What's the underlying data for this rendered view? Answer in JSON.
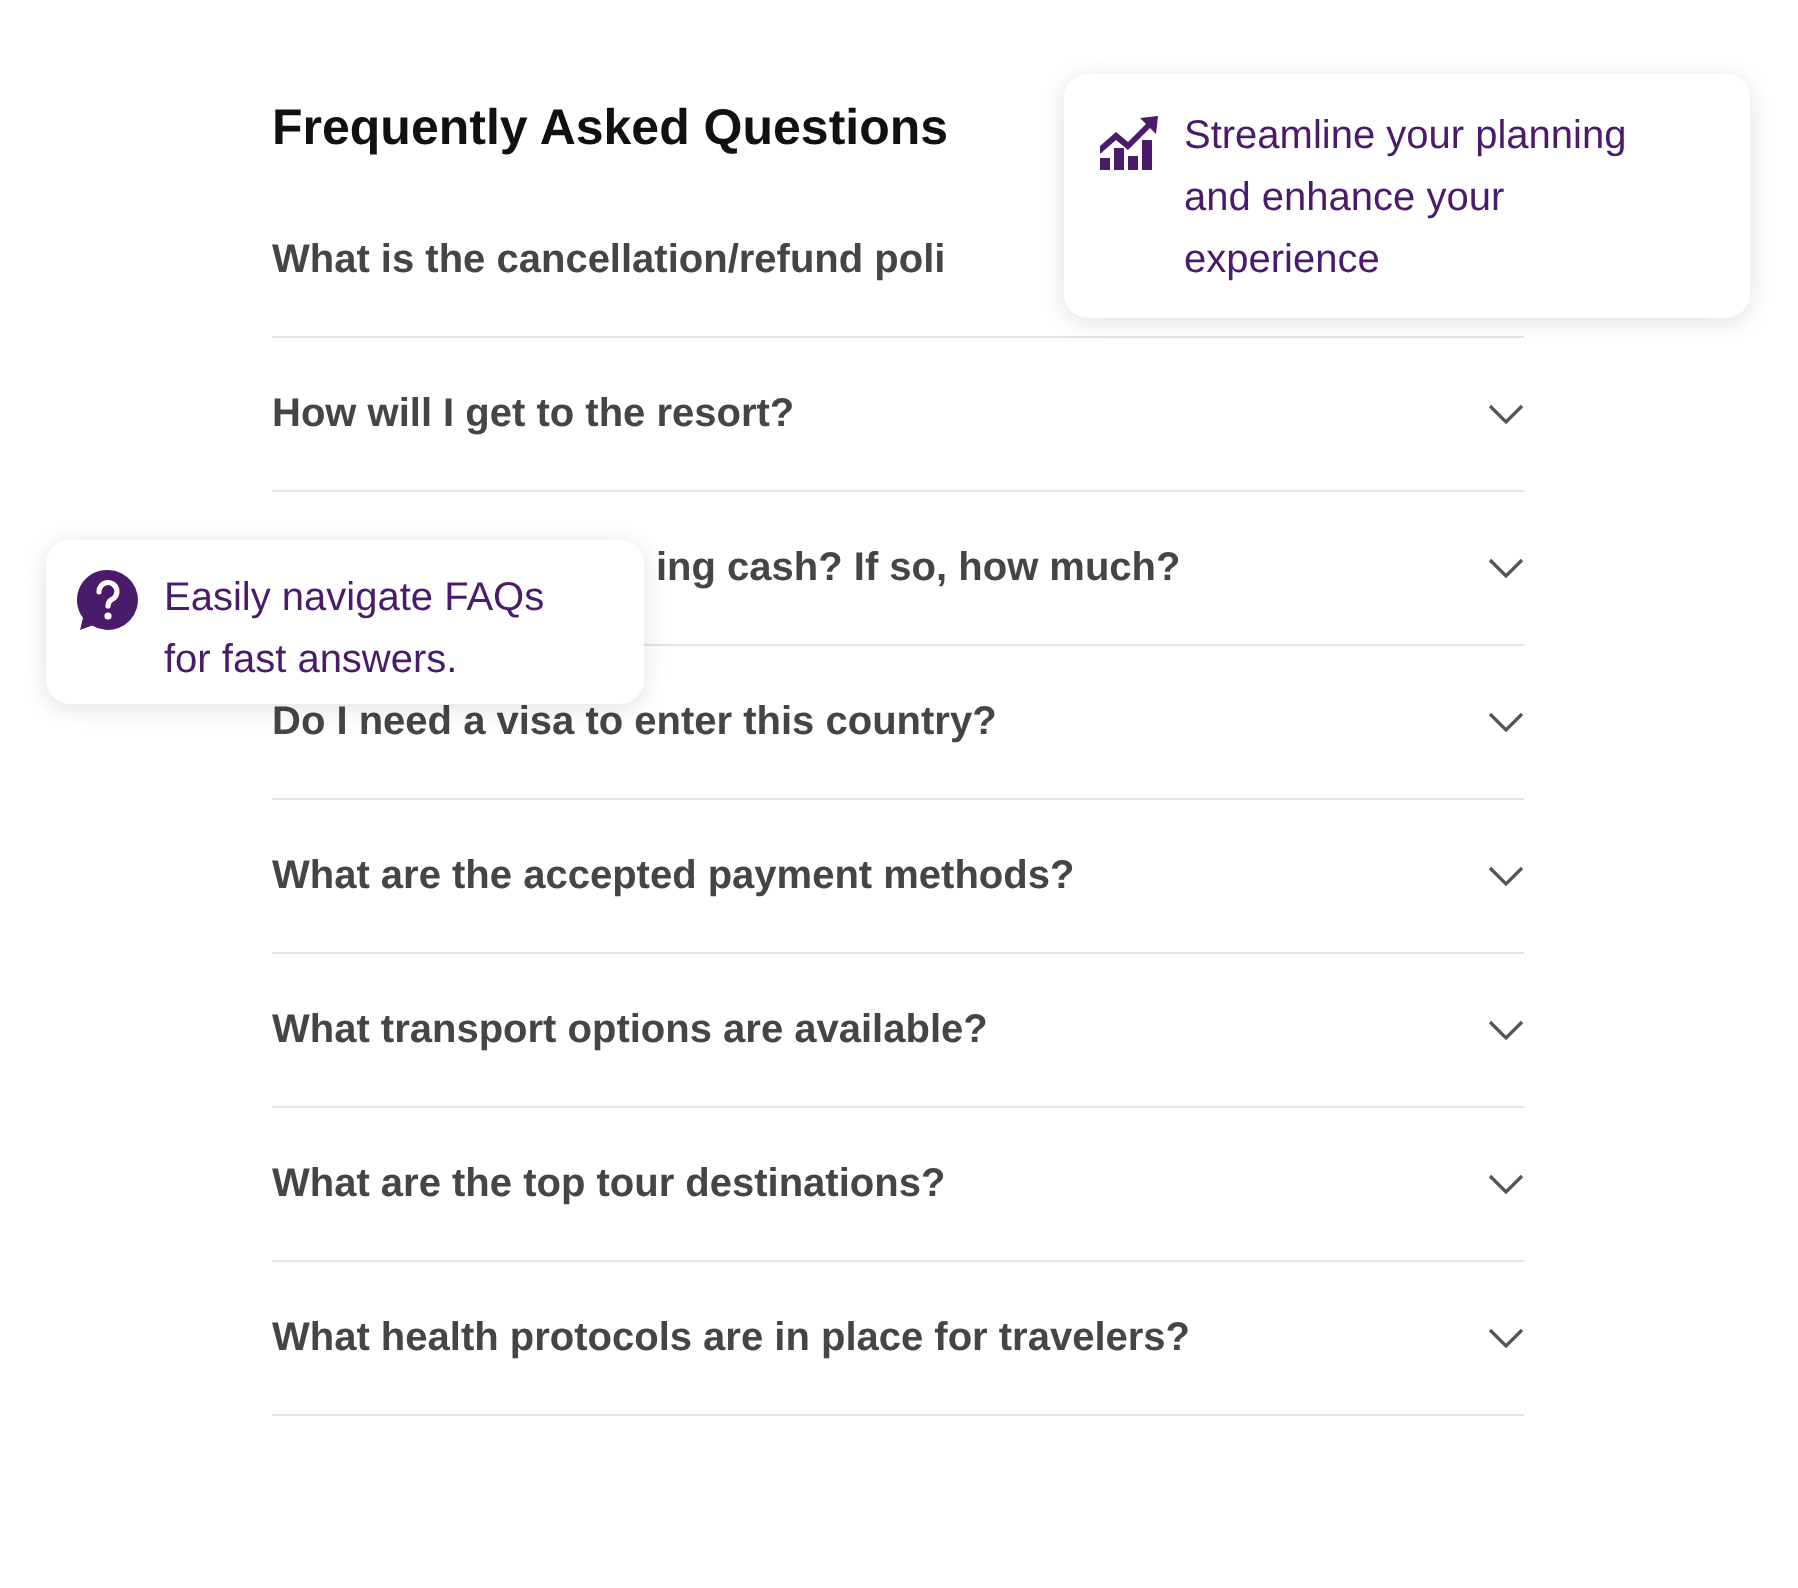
{
  "title": "Frequently Asked Questions",
  "questions": [
    {
      "text": "What is the cancellation/refund poli",
      "kind": "hidden_end"
    },
    {
      "text": "How will I get to the resort?",
      "expanded": false
    },
    {
      "text": "ing cash? If so, how much?",
      "expanded": false,
      "kind": "hidden_start"
    },
    {
      "text": "Do I need a visa to enter this country?",
      "expanded": false
    },
    {
      "text": "What are the accepted payment methods?",
      "expanded": false
    },
    {
      "text": "What transport options are available?",
      "expanded": false
    },
    {
      "text": "What are the top tour destinations?",
      "expanded": false
    },
    {
      "text": "What health protocols are in place for travelers?",
      "expanded": false
    }
  ],
  "callouts": [
    {
      "kind": "chart",
      "text": "Streamline your planning and enhance your experience"
    },
    {
      "kind": "question",
      "text": "Easily navigate FAQs for fast answers."
    }
  ]
}
